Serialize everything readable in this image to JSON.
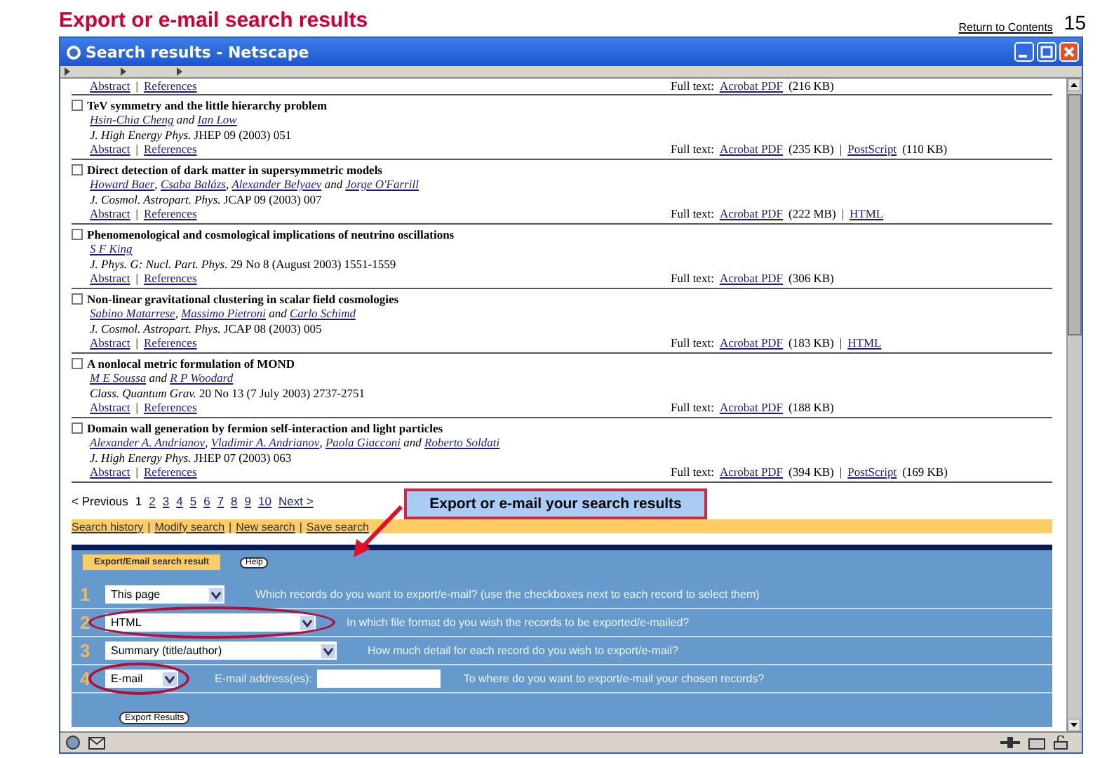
{
  "slide": {
    "title": "Export or e-mail search results",
    "contents_link": "Return to Contents",
    "page_number": "15"
  },
  "window": {
    "title": "Search results - Netscape"
  },
  "link_separator": "|",
  "records": [
    {
      "kind": "partial",
      "links": [
        "Abstract",
        "References"
      ],
      "fulltext_label": "Full text:",
      "files": [
        {
          "format": "Acrobat PDF",
          "size": "(216 KB)"
        }
      ]
    },
    {
      "kind": "full",
      "checked": false,
      "title": "TeV symmetry and the little hierarchy problem",
      "authors": [
        {
          "text": "Hsin-Chia Cheng",
          "link": true
        },
        {
          "text": " and ",
          "link": false
        },
        {
          "text": "Ian Low",
          "link": true
        }
      ],
      "journal": "*J. High Energy Phys.* JHEP 09 (2003) 051",
      "links": [
        "Abstract",
        "References"
      ],
      "fulltext_label": "Full text:",
      "files": [
        {
          "format": "Acrobat PDF",
          "size": "(235 KB)"
        },
        {
          "format": "PostScript",
          "size": "(110 KB)"
        }
      ]
    },
    {
      "kind": "full",
      "checked": false,
      "title": "Direct detection of dark matter in supersymmetric models",
      "authors": [
        {
          "text": "Howard Baer",
          "link": true
        },
        {
          "text": ", ",
          "link": false
        },
        {
          "text": "Csaba Balázs",
          "link": true
        },
        {
          "text": ", ",
          "link": false
        },
        {
          "text": "Alexander Belyaev",
          "link": true
        },
        {
          "text": " and ",
          "link": false
        },
        {
          "text": "Jorge O'Farrill",
          "link": true
        }
      ],
      "journal": "*J. Cosmol. Astropart. Phys.* JCAP 09 (2003) 007",
      "links": [
        "Abstract",
        "References"
      ],
      "fulltext_label": "Full text:",
      "files": [
        {
          "format": "Acrobat PDF",
          "size": "(222 MB)"
        },
        {
          "format": "HTML"
        }
      ]
    },
    {
      "kind": "full",
      "checked": false,
      "title": "Phenomenological and cosmological implications of neutrino oscillations",
      "authors": [
        {
          "text": "S F King",
          "link": true
        }
      ],
      "journal": "*J. Phys. G: Nucl. Part. Phys.* 29 No 8 (August 2003) 1551-1559",
      "links": [
        "Abstract",
        "References"
      ],
      "fulltext_label": "Full text:",
      "files": [
        {
          "format": "Acrobat PDF",
          "size": "(306 KB)"
        }
      ]
    },
    {
      "kind": "full",
      "checked": false,
      "title": "Non-linear gravitational clustering in scalar field cosmologies",
      "authors": [
        {
          "text": "Sabino Matarrese",
          "link": true
        },
        {
          "text": ", ",
          "link": false
        },
        {
          "text": "Massimo Pietroni",
          "link": true
        },
        {
          "text": " and ",
          "link": false
        },
        {
          "text": "Carlo Schimd",
          "link": true
        }
      ],
      "journal": "*J. Cosmol. Astropart. Phys.* JCAP 08 (2003) 005",
      "links": [
        "Abstract",
        "References"
      ],
      "fulltext_label": "Full text:",
      "files": [
        {
          "format": "Acrobat PDF",
          "size": "(183 KB)"
        },
        {
          "format": "HTML"
        }
      ]
    },
    {
      "kind": "full",
      "checked": false,
      "title": "A nonlocal metric formulation of MOND",
      "authors": [
        {
          "text": "M E Soussa",
          "link": true
        },
        {
          "text": " and ",
          "link": false
        },
        {
          "text": "R P Woodard",
          "link": true
        }
      ],
      "journal": "*Class. Quantum Grav.* 20 No 13 (7 July 2003) 2737-2751",
      "links": [
        "Abstract",
        "References"
      ],
      "fulltext_label": "Full text:",
      "files": [
        {
          "format": "Acrobat PDF",
          "size": "(188 KB)"
        }
      ]
    },
    {
      "kind": "full",
      "checked": false,
      "title": "Domain wall generation by fermion self-interaction and light particles",
      "authors": [
        {
          "text": "Alexander A. Andrianov",
          "link": true
        },
        {
          "text": ", ",
          "link": false
        },
        {
          "text": "Vladimir A. Andrianov",
          "link": true
        },
        {
          "text": ", ",
          "link": false
        },
        {
          "text": "Paola Giacconi",
          "link": true
        },
        {
          "text": " and ",
          "link": false
        },
        {
          "text": "Roberto Soldati",
          "link": true
        }
      ],
      "journal": "*J. High Energy Phys.* JHEP 07 (2003) 063",
      "links": [
        "Abstract",
        "References"
      ],
      "fulltext_label": "Full text:",
      "files": [
        {
          "format": "Acrobat PDF",
          "size": "(394 KB)"
        },
        {
          "format": "PostScript",
          "size": "(169 KB)"
        }
      ]
    }
  ],
  "pagination": {
    "previous": "< Previous",
    "pages": [
      {
        "label": "1",
        "selected": true
      },
      {
        "label": "2",
        "selected": false
      },
      {
        "label": "3",
        "selected": false
      },
      {
        "label": "4",
        "selected": false
      },
      {
        "label": "5",
        "selected": false
      },
      {
        "label": "6",
        "selected": false
      },
      {
        "label": "7",
        "selected": false
      },
      {
        "label": "8",
        "selected": false
      },
      {
        "label": "9",
        "selected": false
      },
      {
        "label": "10",
        "selected": false
      }
    ],
    "next": "Next >"
  },
  "callout": {
    "text": "Export or e-mail your search results"
  },
  "nav_links": [
    "Search history",
    "Modify search",
    "New search",
    "Save search"
  ],
  "export": {
    "tab": "Export/Email search result",
    "help": "Help",
    "rows": [
      {
        "number": "1",
        "kind": "select",
        "value": "This page",
        "circled": false,
        "question": "Which records do you want to export/e-mail? (use the checkboxes next to each record to select them)"
      },
      {
        "number": "2",
        "kind": "select",
        "value": "HTML",
        "circled": true,
        "question": "In which file format do you wish the records to be exported/e-mailed?"
      },
      {
        "number": "3",
        "kind": "select",
        "value": "Summary (title/author)",
        "circled": false,
        "question": "How much detail for each record do you wish to export/e-mail?"
      },
      {
        "number": "4",
        "kind": "email",
        "value": "E-mail",
        "circled": true,
        "address_label": "E-mail address(es):",
        "question": "To where do you want to export/e-mail your chosen records?"
      }
    ],
    "button": "Export Results"
  }
}
